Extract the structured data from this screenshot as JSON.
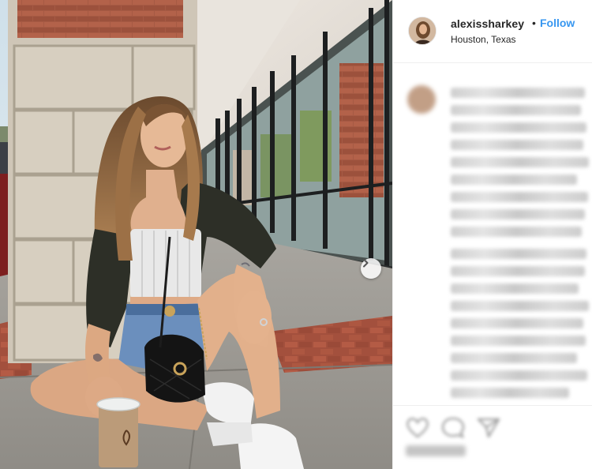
{
  "post": {
    "username": "alexissharkey",
    "separator": "•",
    "follow_label": "Follow",
    "location": "Houston, Texas"
  },
  "media": {
    "carousel_next": "chevron-right-icon"
  },
  "icons": {
    "avatar": "profile-avatar",
    "like": "heart-icon",
    "comment": "comment-icon",
    "share": "share-icon"
  },
  "colors": {
    "follow": "#3897f0",
    "text": "#262626",
    "divider": "#efefef"
  }
}
